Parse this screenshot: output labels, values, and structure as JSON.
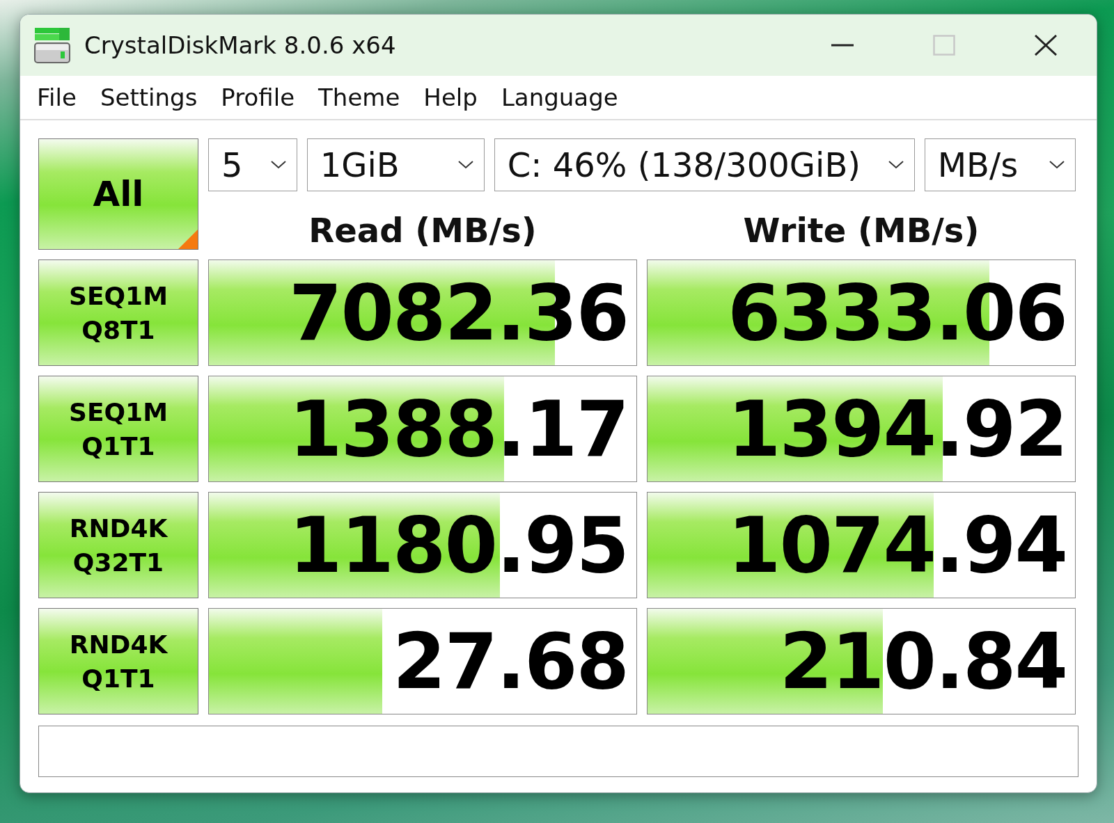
{
  "window": {
    "title": "CrystalDiskMark 8.0.6 x64"
  },
  "window_controls": [
    {
      "kind": "minimize",
      "disabled": false
    },
    {
      "kind": "maximize",
      "disabled": true
    },
    {
      "kind": "close",
      "disabled": false
    }
  ],
  "menu": [
    "File",
    "Settings",
    "Profile",
    "Theme",
    "Help",
    "Language"
  ],
  "all_button": {
    "label": "All"
  },
  "selectors": [
    {
      "value": "5"
    },
    {
      "value": "1GiB"
    },
    {
      "value": "C: 46% (138/300GiB)"
    },
    {
      "value": "MB/s"
    }
  ],
  "headers": {
    "read": "Read (MB/s)",
    "write": "Write (MB/s)"
  },
  "tests": [
    {
      "label": [
        "SEQ1M",
        "Q8T1"
      ],
      "read": {
        "value": "7082.36",
        "level": 0.81
      },
      "write": {
        "value": "6333.06",
        "level": 0.8
      }
    },
    {
      "label": [
        "SEQ1M",
        "Q1T1"
      ],
      "read": {
        "value": "1388.17",
        "level": 0.69
      },
      "write": {
        "value": "1394.92",
        "level": 0.69
      }
    },
    {
      "label": [
        "RND4K",
        "Q32T1"
      ],
      "read": {
        "value": "1180.95",
        "level": 0.68
      },
      "write": {
        "value": "1074.94",
        "level": 0.67
      }
    },
    {
      "label": [
        "RND4K",
        "Q1T1"
      ],
      "read": {
        "value": "27.68",
        "level": 0.405
      },
      "write": {
        "value": "210.84",
        "level": 0.55
      }
    }
  ]
}
